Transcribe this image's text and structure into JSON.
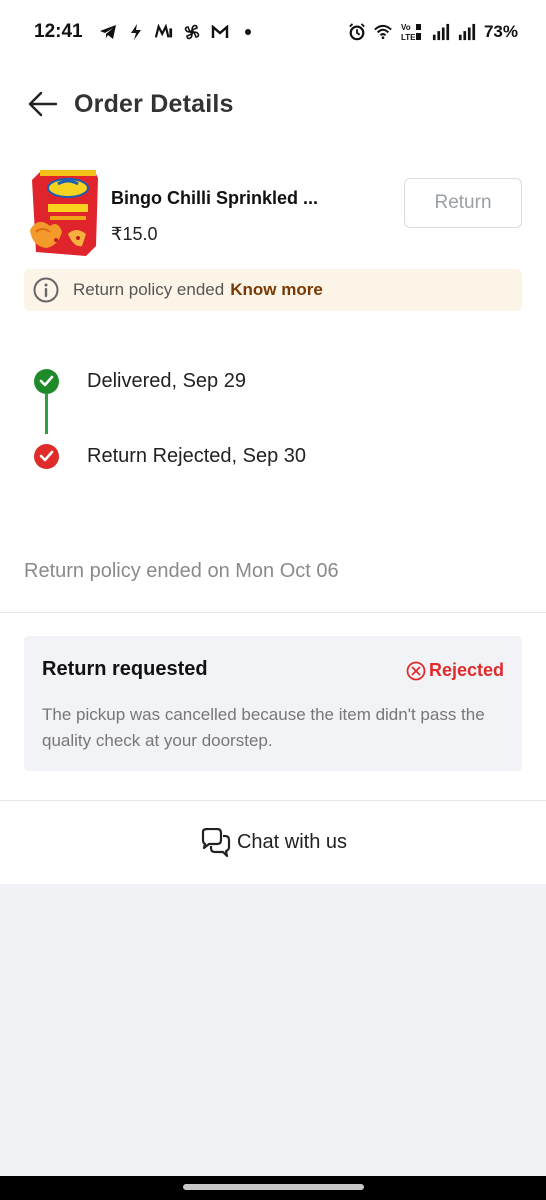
{
  "status_bar": {
    "time": "12:41",
    "left_icons": [
      "telegram-icon",
      "flash-icon",
      "app-icon",
      "pinwheel-icon",
      "gmail-icon",
      "dot-icon"
    ],
    "right_icons": [
      "alarm-icon",
      "wifi-icon",
      "volte-icon",
      "signal-icon",
      "signal-icon"
    ],
    "volte_label": "Vo LTE",
    "battery": "73%"
  },
  "header": {
    "title": "Order Details"
  },
  "product": {
    "name": "Bingo Chilli Sprinkled ...",
    "price": "₹15.0",
    "return_label": "Return"
  },
  "policy_banner": {
    "text": "Return policy ended",
    "link": "Know more"
  },
  "timeline": [
    {
      "label": "Delivered, Sep 29",
      "status": "done",
      "color": "#2e9e3f"
    },
    {
      "label": "Return Rejected, Sep 30",
      "status": "rejected",
      "color": "#e02b2b"
    }
  ],
  "policy_end_text": "Return policy ended on Mon Oct 06",
  "return_request": {
    "title": "Return requested",
    "status": "Rejected",
    "status_color": "#e02b2b",
    "description": "The pickup was cancelled because the item didn't pass the quality check at your doorstep."
  },
  "chat": {
    "label": "Chat with us"
  }
}
